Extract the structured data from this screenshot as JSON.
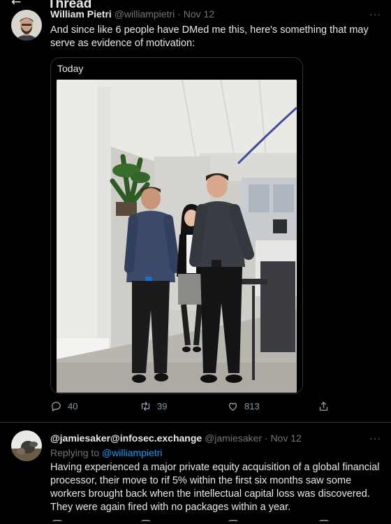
{
  "header": {
    "back_icon": "arrow-left-icon",
    "title": "Thread"
  },
  "main_tweet": {
    "author_name": "William Pietri",
    "author_handle": "@williampietri",
    "separator": "·",
    "date": "Nov 12",
    "more_icon": "more-horizontal-icon",
    "more_label": "···",
    "text": "And since like 6 people have DMed me this, here's something that may serve as evidence of motivation:",
    "media": {
      "caption": "Today",
      "image_icon": "office-photo-three-people"
    },
    "actions": {
      "replies": "40",
      "retweets": "39",
      "likes": "813",
      "reply_icon": "reply-icon",
      "retweet_icon": "retweet-icon",
      "like_icon": "heart-icon",
      "share_icon": "share-icon"
    }
  },
  "reply_tweet": {
    "author_name": "@jamiesaker@infosec.exchange",
    "author_handle": "@jamiesaker",
    "separator": "·",
    "date": "Nov 12",
    "more_label": "···",
    "replying_prefix": "Replying to",
    "replying_mention": "@williampietri",
    "text": "Having experienced a major private equity acquisition of a global financial processor, their move to rif 5% within the first six months saw some workers brought back when the intellectual capital loss was discovered. They were again fired with no packages within a year."
  },
  "colors": {
    "background": "#000000",
    "text": "#e7e9ea",
    "muted": "#71767b",
    "accent": "#1d9bf0",
    "border": "#2f3336"
  }
}
